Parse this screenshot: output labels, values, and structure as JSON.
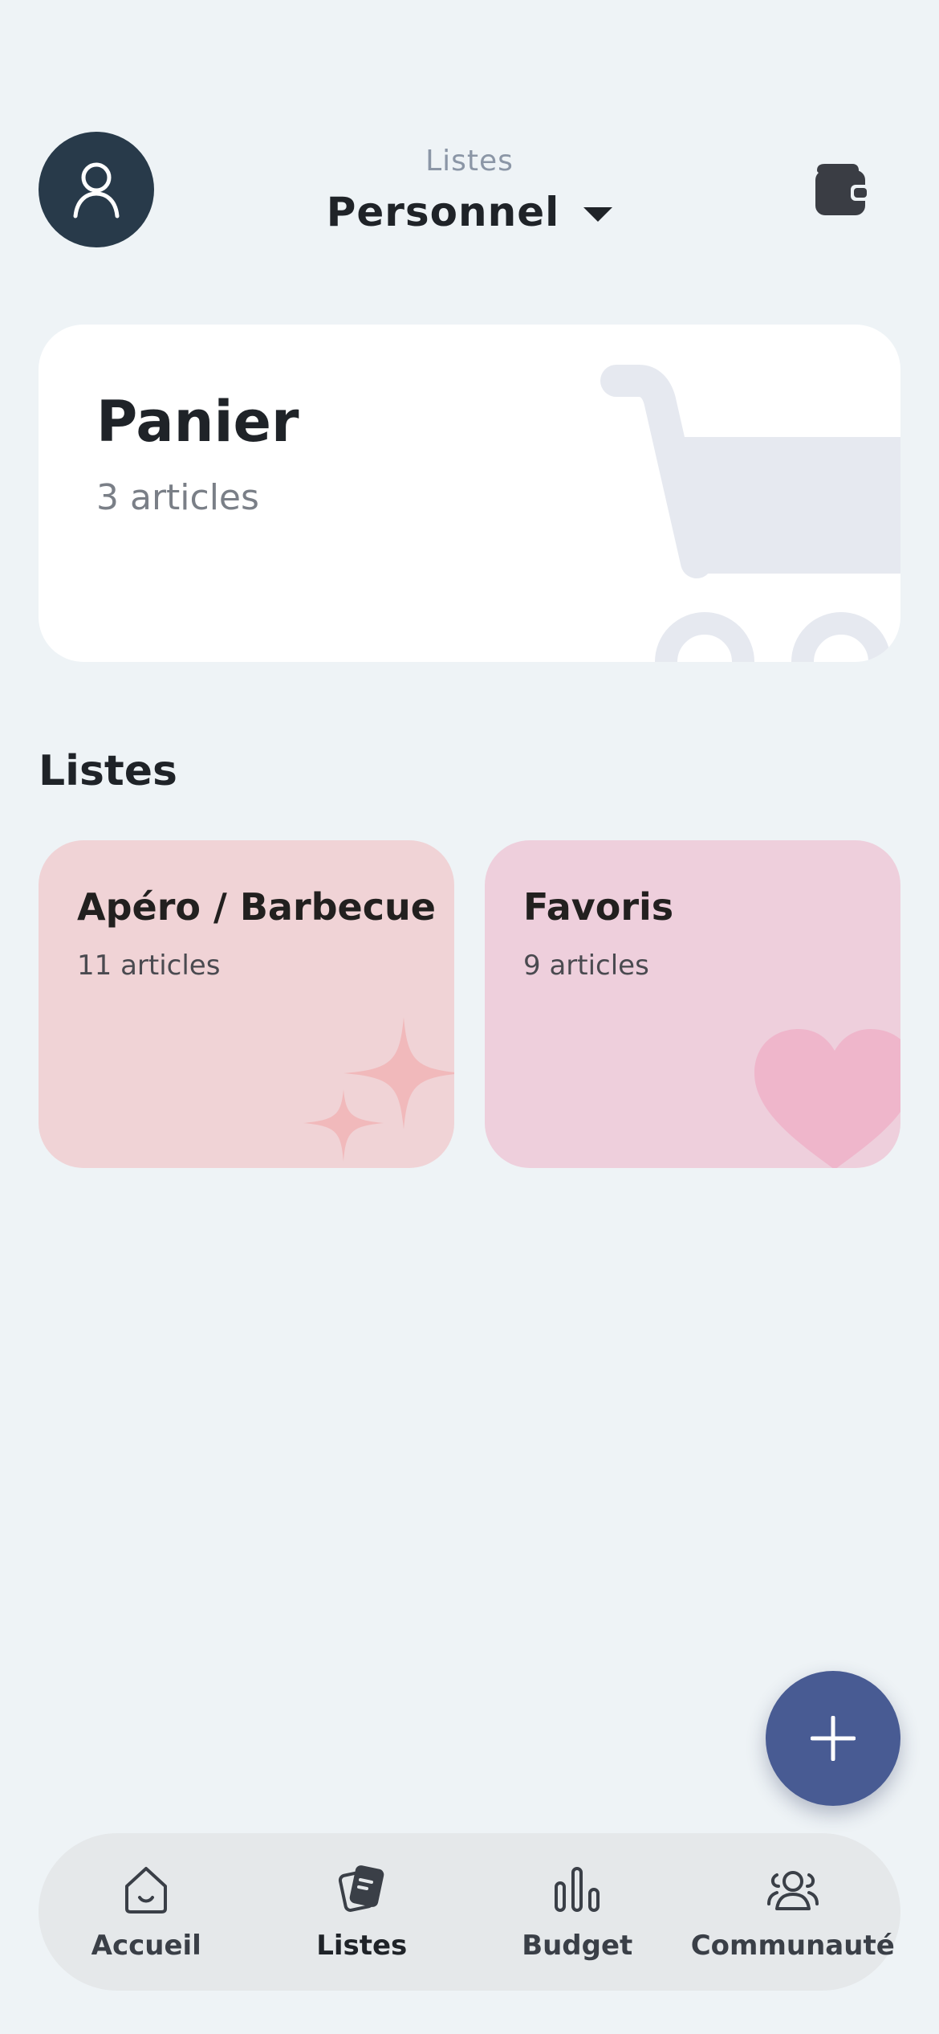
{
  "header": {
    "subtitle": "Listes",
    "title": "Personnel",
    "avatar_icon": "user-icon",
    "wallet_icon": "wallet-icon",
    "dropdown_icon": "caret-down-icon"
  },
  "panier": {
    "title": "Panier",
    "count": "3 articles",
    "art_icon": "shopping-cart-icon"
  },
  "section": {
    "title": "Listes"
  },
  "lists": [
    {
      "title": "Apéro / Barbecue",
      "count": "11 articles",
      "color": "#f0d3d6",
      "icon": "sparkle-icon"
    },
    {
      "title": "Favoris",
      "count": "9 articles",
      "color": "#eecfdc",
      "icon": "heart-icon"
    }
  ],
  "fab": {
    "icon": "plus-icon",
    "color": "#485b93"
  },
  "nav": {
    "items": [
      {
        "label": "Accueil",
        "icon": "home-icon"
      },
      {
        "label": "Listes",
        "icon": "lists-icon",
        "active": true
      },
      {
        "label": "Budget",
        "icon": "bar-chart-icon"
      },
      {
        "label": "Communauté",
        "icon": "community-icon"
      }
    ]
  }
}
